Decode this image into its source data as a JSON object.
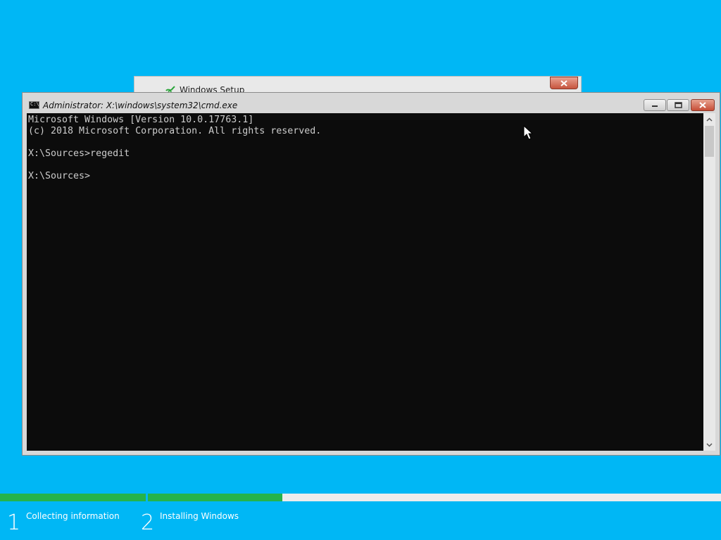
{
  "setup_window": {
    "title": "Windows Setup",
    "close_icon": "close-icon",
    "logo_icon": "windows-setup-icon"
  },
  "cmd_window": {
    "title": "Administrator: X:\\windows\\system32\\cmd.exe",
    "app_icon": "cmd-icon",
    "app_icon_text": "C:\\",
    "buttons": {
      "minimize_icon": "minimize-icon",
      "maximize_icon": "maximize-icon",
      "close_icon": "close-icon"
    },
    "console_lines": [
      "Microsoft Windows [Version 10.0.17763.1]",
      "(c) 2018 Microsoft Corporation. All rights reserved.",
      "",
      "X:\\Sources>regedit",
      "",
      "X:\\Sources>"
    ]
  },
  "progress": {
    "steps": [
      {
        "number": "1",
        "label": "Collecting information",
        "fill": 1.0
      },
      {
        "number": "2",
        "label": "Installing Windows",
        "fill": 0.235
      }
    ]
  },
  "colors": {
    "desktop_background": "#00b7f5",
    "progress_fill": "#25b34a",
    "console_background": "#0c0c0c",
    "console_text": "#cccccc"
  }
}
